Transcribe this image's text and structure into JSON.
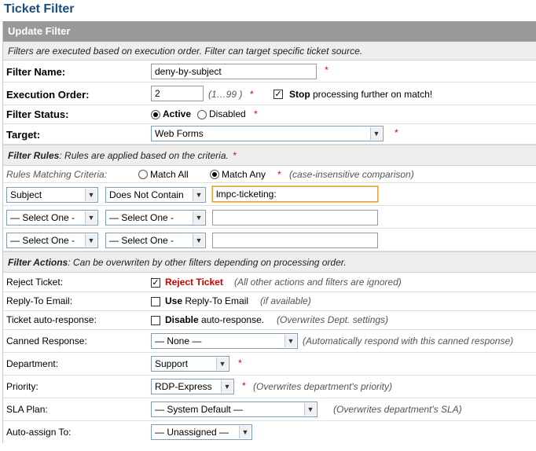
{
  "title": "Ticket Filter",
  "header": "Update Filter",
  "intro": "Filters are executed based on execution order. Filter can target specific ticket source.",
  "filter_name": {
    "label": "Filter Name:",
    "value": "deny-by-subject"
  },
  "execution_order": {
    "label": "Execution Order:",
    "value": "2",
    "hint": "(1…99 )",
    "stop_bold": "Stop",
    "stop_rest": " processing further on match!"
  },
  "filter_status": {
    "label": "Filter Status:",
    "active": "Active",
    "disabled": "Disabled"
  },
  "target": {
    "label": "Target:",
    "value": "Web Forms"
  },
  "rules_section": {
    "title": "Filter Rules",
    "text": ": Rules are applied based on the criteria."
  },
  "criteria": {
    "label": "Rules Matching Criteria:",
    "all": "Match All",
    "any": "Match Any",
    "note": "(case-insensitive comparison)"
  },
  "rules": [
    {
      "field": "Subject",
      "op": "Does Not Contain",
      "value": "lmpc-ticketing:"
    },
    {
      "field": "— Select One -",
      "op": "— Select One -",
      "value": ""
    },
    {
      "field": "— Select One -",
      "op": "— Select One -",
      "value": ""
    }
  ],
  "actions_section": {
    "title": "Filter Actions",
    "text": ": Can be overwriten by other filters depending on processing order."
  },
  "reject": {
    "label": "Reject Ticket:",
    "text": "Reject Ticket",
    "note": "(All other actions and filters are ignored)"
  },
  "reply_to": {
    "label": "Reply-To Email:",
    "bold": "Use",
    "rest": " Reply-To Email",
    "note": "(if available)"
  },
  "auto_response": {
    "label": "Ticket auto-response:",
    "bold": "Disable",
    "rest": " auto-response.",
    "note": "(Overwrites Dept. settings)"
  },
  "canned": {
    "label": "Canned Response:",
    "value": "— None —",
    "note": "(Automatically respond with this canned response)"
  },
  "department": {
    "label": "Department:",
    "value": "Support"
  },
  "priority": {
    "label": "Priority:",
    "value": "RDP-Express",
    "note": "(Overwrites department's priority)"
  },
  "sla": {
    "label": "SLA Plan:",
    "value": "— System Default —",
    "note": "(Overwrites department's SLA)"
  },
  "assign": {
    "label": "Auto-assign To:",
    "value": "— Unassigned —"
  },
  "required_mark": "*",
  "colors": {
    "title": "#184E81",
    "header_bg": "#999999",
    "required": "#ee0000",
    "reject": "#cc0000"
  }
}
